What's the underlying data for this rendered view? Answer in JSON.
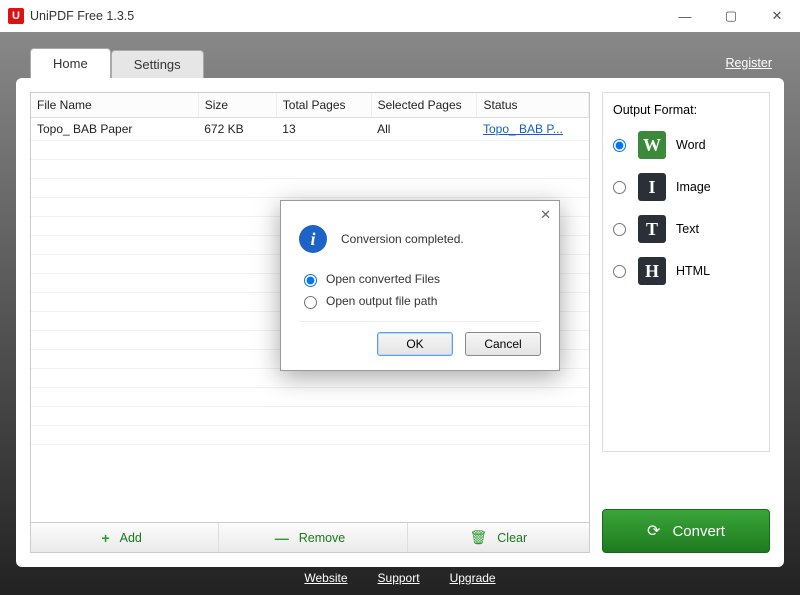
{
  "window": {
    "title": "UniPDF Free 1.3.5"
  },
  "register_label": "Register",
  "tabs": {
    "home": "Home",
    "settings": "Settings"
  },
  "columns": {
    "file_name": "File Name",
    "size": "Size",
    "total_pages": "Total Pages",
    "selected_pages": "Selected Pages",
    "status": "Status"
  },
  "rows": [
    {
      "file_name": "Topo_ BAB Paper",
      "size": "672 KB",
      "total_pages": "13",
      "selected_pages": "All",
      "status": "Topo_ BAB P..."
    }
  ],
  "toolbar": {
    "add": "Add",
    "remove": "Remove",
    "clear": "Clear"
  },
  "output": {
    "heading": "Output Format:",
    "word": "Word",
    "image": "Image",
    "text": "Text",
    "html": "HTML",
    "icon_word": "W",
    "icon_image": "I",
    "icon_text": "T",
    "icon_html": "H"
  },
  "convert_label": "Convert",
  "footer": {
    "website": "Website",
    "support": "Support",
    "upgrade": "Upgrade"
  },
  "dialog": {
    "message": "Conversion completed.",
    "opt_open_files": "Open converted Files",
    "opt_open_path": "Open output file path",
    "ok": "OK",
    "cancel": "Cancel"
  }
}
